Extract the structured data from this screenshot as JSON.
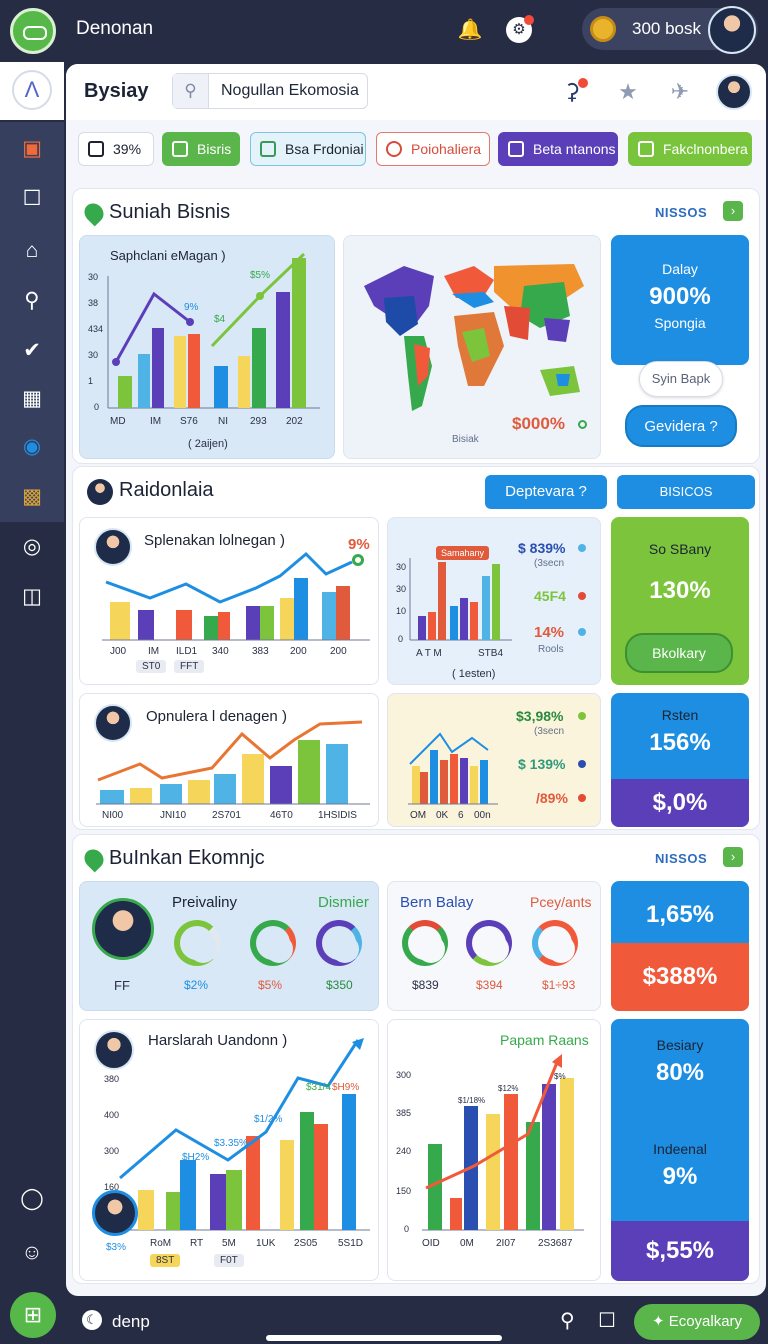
{
  "app": {
    "title": "Denonan",
    "balance_label": "300 bosk"
  },
  "header": {
    "title": "Bysiay",
    "search_value": "Nogullan Ekomosia"
  },
  "filters": [
    {
      "label": "39%",
      "color": "#1d2233",
      "bg": "#ffffff",
      "border": "#d6dbe6"
    },
    {
      "label": "Bisris",
      "color": "#ffffff",
      "bg": "#5ab64a",
      "border": "#5ab64a"
    },
    {
      "label": "Bsa Frdoniai",
      "color": "#1d2233",
      "bg": "#e4f2f9",
      "border": "#7cc4e2"
    },
    {
      "label": "Poiohaliera",
      "color": "#d94b3a",
      "bg": "#ffffff",
      "border": "#e07b6b"
    },
    {
      "label": "Beta ntanons",
      "color": "#ffffff",
      "bg": "#5a3fb8",
      "border": "#5a3fb8"
    },
    {
      "label": "Fakclnonbera",
      "color": "#ffffff",
      "bg": "#78c43c",
      "border": "#78c43c"
    }
  ],
  "section1": {
    "title": "Suniah Bisnis",
    "link": "NISSOS",
    "chart": {
      "title": "Saphclani eMagan )",
      "ylabels": [
        "30",
        "38",
        "434",
        "30",
        "1",
        "0"
      ],
      "categories": [
        "MD",
        "IM",
        "S76",
        "NI",
        "293",
        "202"
      ],
      "xlabel": "( 2aijen)",
      "annotations": [
        "$5%",
        "9%",
        "$4"
      ]
    },
    "map": {
      "label": "Bisiak",
      "value": "$000%"
    },
    "stat": {
      "top": "Dalay",
      "value": "900%",
      "bottom": "Spongia"
    },
    "outline_button": "Syin Bapk",
    "blue_button": "Gevidera ?"
  },
  "section2": {
    "title": "Raidonlaia",
    "button1": "Deptevara ?",
    "button2": "BISICOS",
    "card1": {
      "title": "Splenakan lolnegan )",
      "badge": "9%",
      "xlabels": [
        "J00",
        "IM",
        "ILD1",
        "340",
        "383",
        "200",
        "200"
      ],
      "chips": [
        "ST0",
        "FFT"
      ]
    },
    "card2": {
      "chip": "Samahany",
      "xlabels": [
        "A T M",
        "STB4"
      ],
      "xlabel": "( 1esten)",
      "legend": [
        {
          "value": "$ 839%",
          "sub": "(3secn",
          "color": "#2a4fb0",
          "dot": "#4fb3e6"
        },
        {
          "value": "45F4",
          "sub": "",
          "color": "#7cc43c",
          "dot": "#e24b35"
        },
        {
          "value": "14%",
          "sub": "Rools",
          "color": "#e05a3c",
          "dot": "#4fb3e6"
        }
      ]
    },
    "green_stat": {
      "title": "So SBany",
      "value": "130%",
      "button": "Bkolkary"
    },
    "card3": {
      "title": "Opnulera l denagen )",
      "xlabels": [
        "NI00",
        "JNI10",
        "2S701",
        "46T0",
        "1HSIDIS"
      ]
    },
    "card4": {
      "xlabels": [
        "OM",
        "0K",
        "6",
        "00n"
      ],
      "legend": [
        {
          "value": "$3,98%",
          "sub": "(3secn",
          "color": "#2a8a3c",
          "dot": "#7cc43c"
        },
        {
          "value": "$ 139%",
          "sub": "",
          "color": "#2f9a7a",
          "dot": "#2a4fb0"
        },
        {
          "value": "/89%",
          "sub": "",
          "color": "#e05a3c",
          "dot": "#e24b35"
        }
      ]
    },
    "split_stat": {
      "title": "Rsten",
      "value": "156%",
      "bottom": "$,0%"
    }
  },
  "section3": {
    "title": "BuInkan Ekomnjc",
    "link": "NISSOS",
    "card1": {
      "title": "Preivaliny",
      "green_title": "Dismier",
      "labels": [
        "FF",
        "$2%",
        "$5%",
        "$350"
      ]
    },
    "card2": {
      "title": "Bern Balay",
      "red_title": "Pcey/ants",
      "labels": [
        "$839",
        "$394",
        "$1÷93"
      ]
    },
    "stat_top": {
      "value": "1,65%",
      "bottom": "$388%"
    },
    "card3": {
      "title": "Harslarah Uandonn )",
      "ylabels": [
        "380",
        "400",
        "300",
        "160"
      ],
      "annotations": [
        "$1/2%",
        "$3.35%",
        "$H2%",
        "$31/4",
        "$H9%",
        "$3%"
      ],
      "xlabels": [
        "RoM",
        "RT",
        "5M",
        "1UK",
        "2S05",
        "5S1D"
      ],
      "chips": [
        "8ST",
        "F0T"
      ]
    },
    "card4": {
      "title": "Papam Raans",
      "ylabels": [
        "300",
        "385",
        "240",
        "150",
        "0"
      ],
      "annotations": [
        "$1/18%",
        "$12%",
        "$%"
      ],
      "xlabels": [
        "OID",
        "0M",
        "2I07",
        "2S3687"
      ]
    },
    "stat_bottom": {
      "title": "Besiary",
      "value": "80%",
      "mid": "Indeenal",
      "mid_value": "9%",
      "bottom": "$,55%"
    }
  },
  "bottom": {
    "label": "denp",
    "button": "Ecoyalkary"
  },
  "colors": {
    "navy": "#262c44",
    "blue": "#1e8ee2",
    "green": "#5ab64a",
    "purple": "#5a3fb8",
    "red": "#f05a3a",
    "orange": "#f0922e",
    "yellow": "#f5d65b"
  },
  "icons": [
    "bell-icon",
    "notification-icon",
    "coin-icon",
    "search-icon",
    "key-icon",
    "star-icon",
    "plane-icon",
    "chat-icon",
    "home-icon"
  ]
}
